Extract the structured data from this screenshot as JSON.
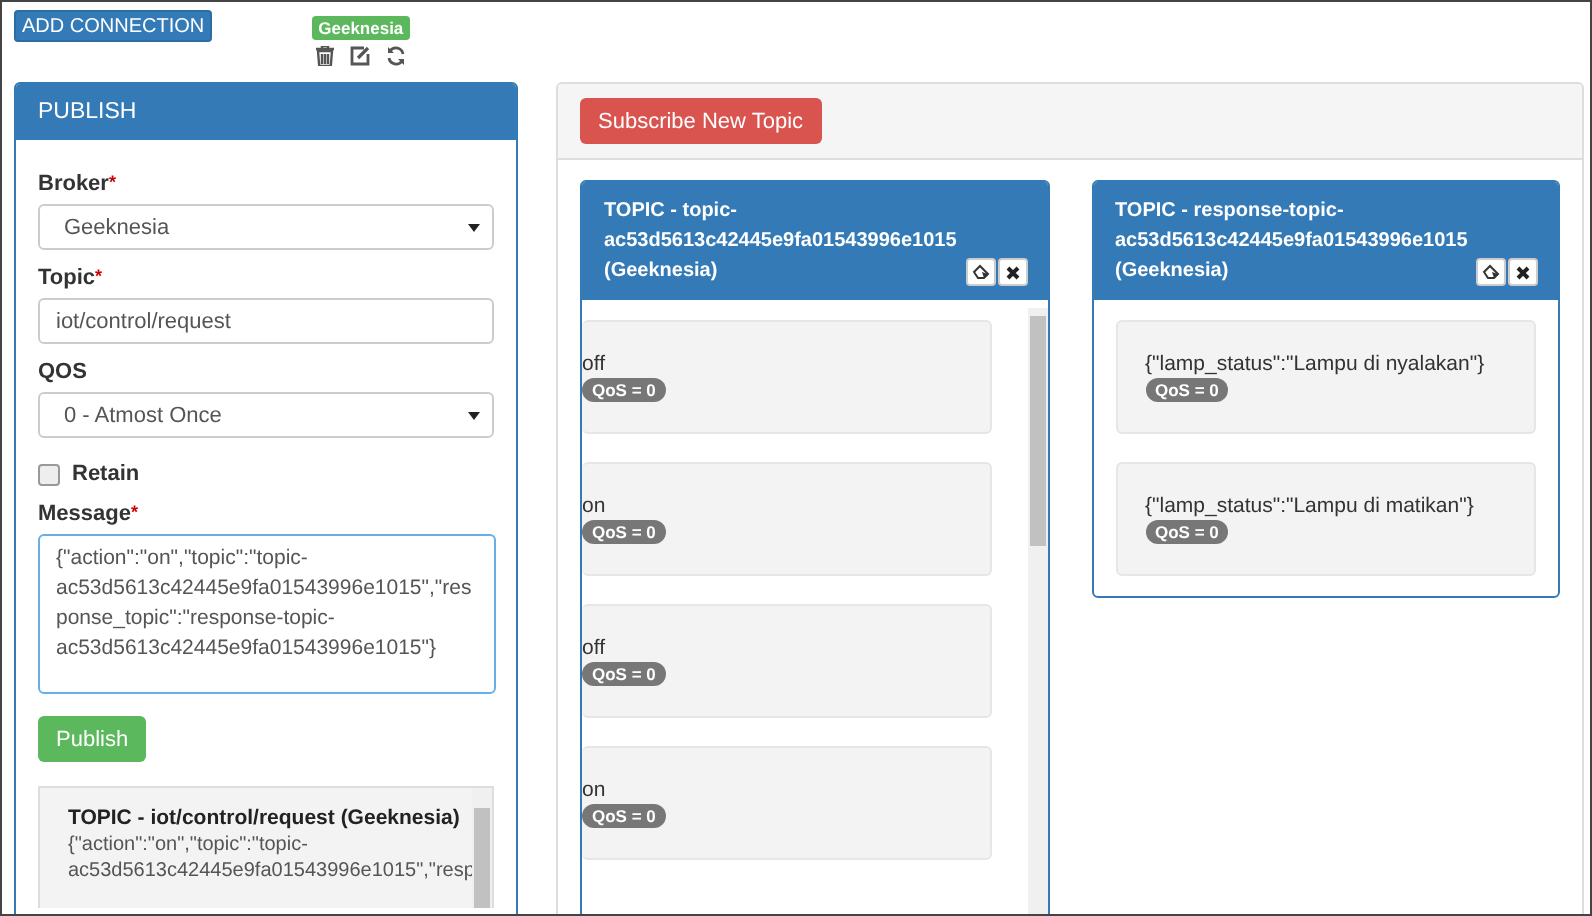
{
  "toolbar": {
    "add_connection": "ADD CONNECTION",
    "connection_badge": "Geeknesia"
  },
  "publish": {
    "title": "PUBLISH",
    "broker": {
      "label": "Broker",
      "required_mark": "*",
      "value": "Geeknesia"
    },
    "topic": {
      "label": "Topic",
      "required_mark": "*",
      "value": "iot/control/request"
    },
    "qos": {
      "label": "QOS",
      "value": "0 - Atmost Once"
    },
    "retain": {
      "label": "Retain",
      "checked": false
    },
    "message": {
      "label": "Message",
      "required_mark": "*",
      "value": "{\"action\":\"on\",\"topic\":\"topic-ac53d5613c42445e9fa01543996e1015\",\"response_topic\":\"response-topic-ac53d5613c42445e9fa01543996e1015\"}"
    },
    "button": "Publish",
    "log": [
      {
        "title": "TOPIC - iot/control/request (Geeknesia)",
        "lines": [
          "{\"action\":\"on\",\"topic\":\"topic-",
          "ac53d5613c42445e9fa01543996e1015\",\"resp"
        ]
      }
    ]
  },
  "subscribe_button": "Subscribe New Topic",
  "topics": [
    {
      "title": "TOPIC - topic-ac53d5613c42445e9fa01543996e1015 (Geeknesia)",
      "scrolled": true,
      "messages": [
        {
          "text": "off",
          "qos": "QoS = 0"
        },
        {
          "text": "on",
          "qos": "QoS = 0"
        },
        {
          "text": "off",
          "qos": "QoS = 0"
        },
        {
          "text": "on",
          "qos": "QoS = 0"
        }
      ]
    },
    {
      "title": "TOPIC - response-topic-ac53d5613c42445e9fa01543996e1015 (Geeknesia)",
      "scrolled": false,
      "messages": [
        {
          "text": "{\"lamp_status\":\"Lampu di nyalakan\"}",
          "qos": "QoS = 0"
        },
        {
          "text": "{\"lamp_status\":\"Lampu di matikan\"}",
          "qos": "QoS = 0"
        }
      ]
    }
  ]
}
